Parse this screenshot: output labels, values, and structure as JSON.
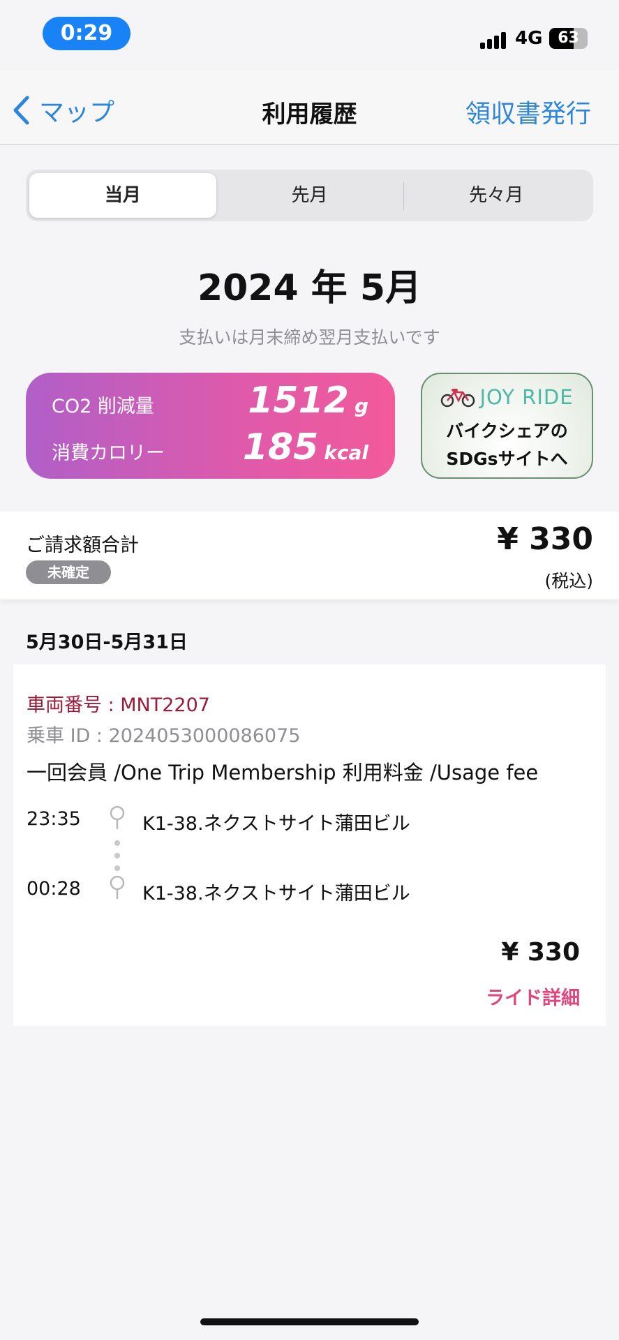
{
  "status_bar": {
    "time": "0:29",
    "network": "4G",
    "battery": "63",
    "battery_level": 0.63,
    "signal_bars": 4
  },
  "nav": {
    "back_label": "マップ",
    "title": "利用履歴",
    "action_label": "領収書発行",
    "accent_color": "#2d86d9"
  },
  "segments": [
    {
      "label": "当月",
      "active": true
    },
    {
      "label": "先月",
      "active": false
    },
    {
      "label": "先々月",
      "active": false
    }
  ],
  "period": {
    "title": "2024 年 5月",
    "note": "支払いは月末締め翌月支払いです"
  },
  "eco": {
    "co2_label": "CO2 削減量",
    "co2_value": "1512",
    "co2_unit": "g",
    "calorie_label": "消費カロリー",
    "calorie_value": "185",
    "calorie_unit": "kcal"
  },
  "sdg_banner": {
    "brand": "JOY RIDE",
    "line1": "バイクシェアの",
    "line2": "SDGsサイトへ"
  },
  "billing": {
    "label": "ご請求額合計",
    "badge": "未確定",
    "amount": "¥ 330",
    "tax_note": "(税込)"
  },
  "ride_group": {
    "date_range": "5月30日-5月31日",
    "rides": [
      {
        "vehicle": "車両番号 : MNT2207",
        "ride_id": "乗車 ID : 2024053000086075",
        "plan": "一回会員 /One Trip Membership 利用料金 /Usage fee",
        "start_time": "23:35",
        "start_station": "K1-38.ネクストサイト蒲田ビル",
        "end_time": "00:28",
        "end_station": "K1-38.ネクストサイト蒲田ビル",
        "fare": "¥ 330",
        "detail_link": "ライド詳細"
      }
    ]
  }
}
